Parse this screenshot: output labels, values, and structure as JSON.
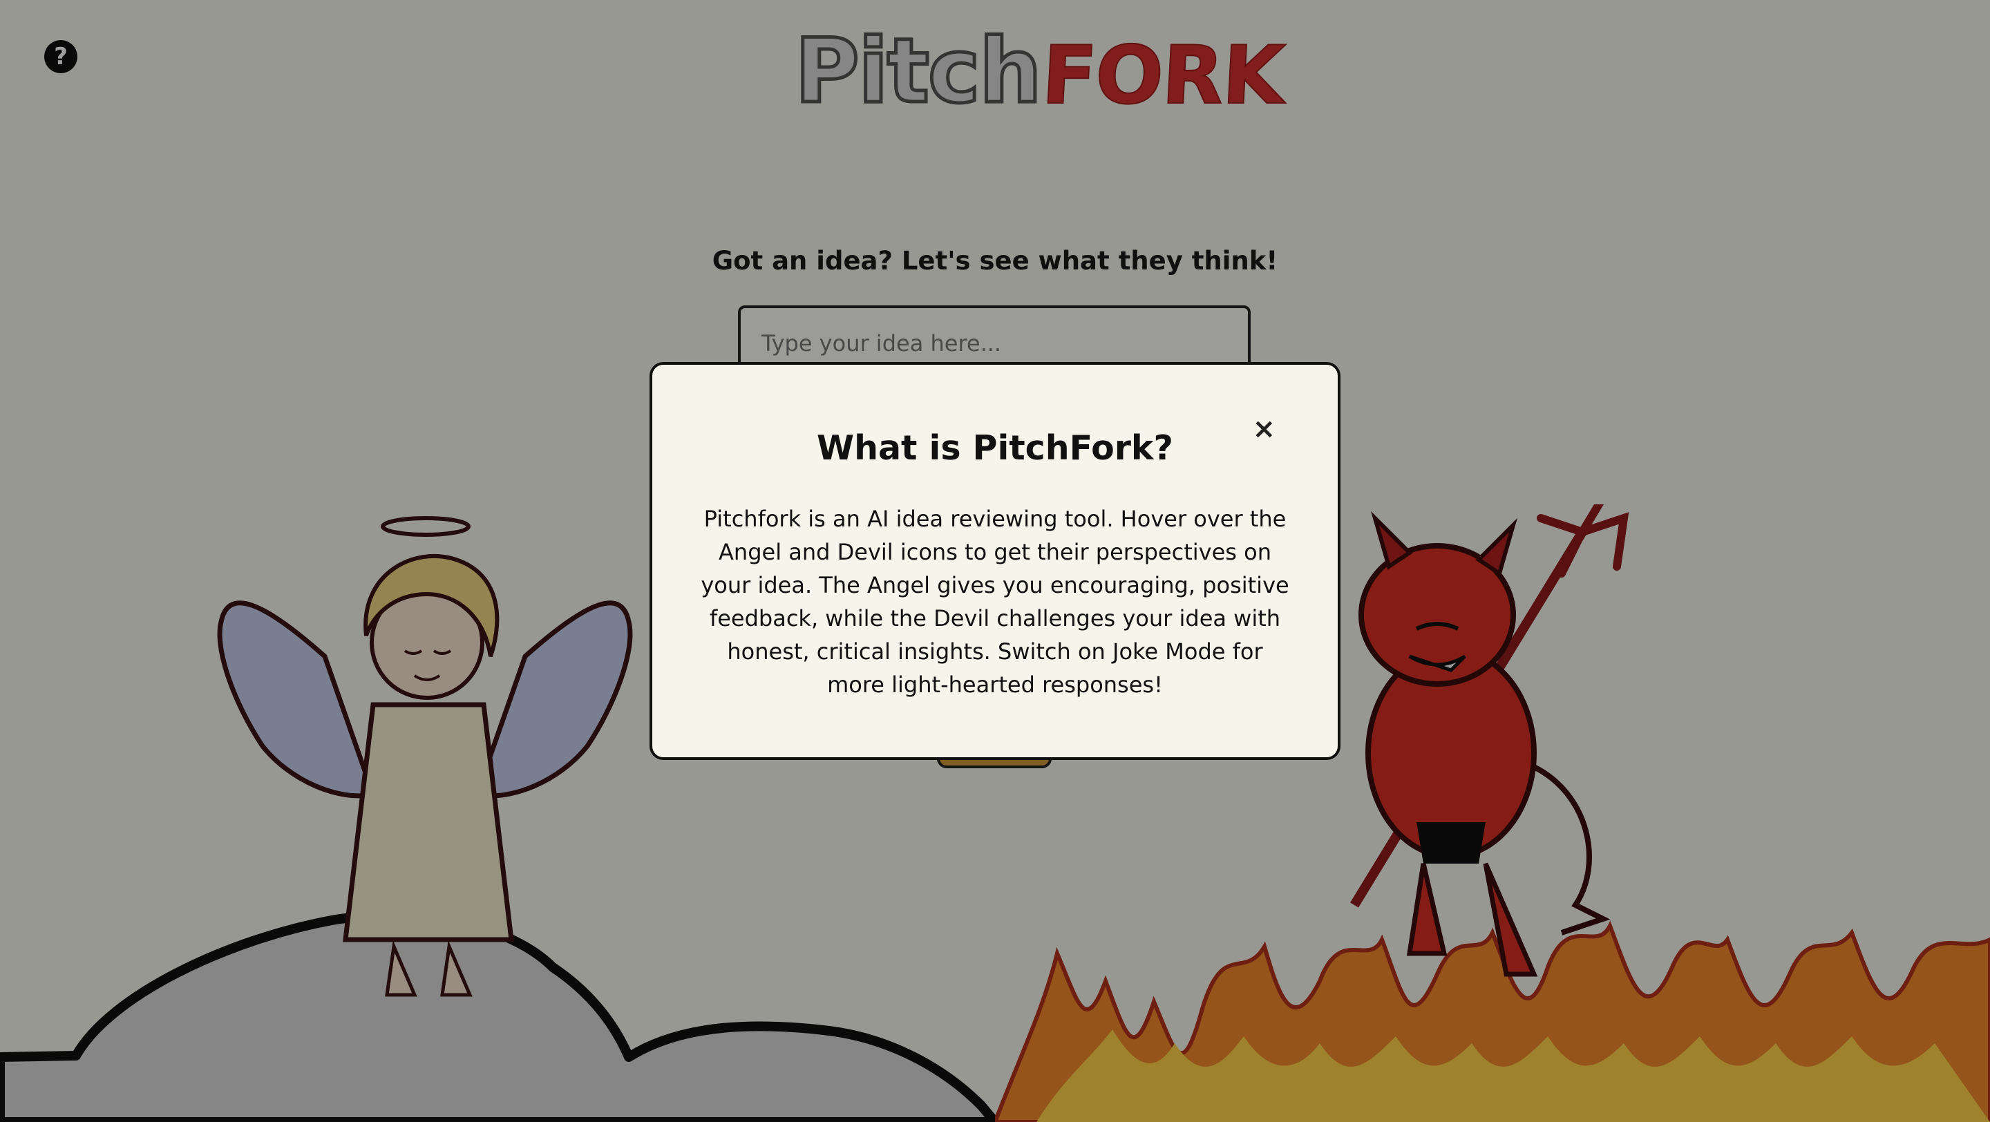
{
  "app": {
    "logo_part1": "Pitch",
    "logo_part2": "FORK",
    "help_icon": "question-circle-icon"
  },
  "main": {
    "prompt": "Got an idea? Let's see what they think!",
    "idea_input_placeholder": "Type your idea here...",
    "idea_input_value": ""
  },
  "modal": {
    "title": "What is PitchFork?",
    "close_label": "×",
    "body": "Pitchfork is an AI idea reviewing tool. Hover over the Angel and Devil icons to get their perspectives on your idea. The Angel gives you encouraging, positive feedback, while the Devil challenges your idea with honest, critical insights. Switch on Joke Mode for more light-hearted responses!"
  },
  "colors": {
    "background": "#f5f5ee",
    "overlay": "rgba(0,0,0,0.38)",
    "fork_red": "#d0302e",
    "modal_bg": "#f5f5ec"
  }
}
